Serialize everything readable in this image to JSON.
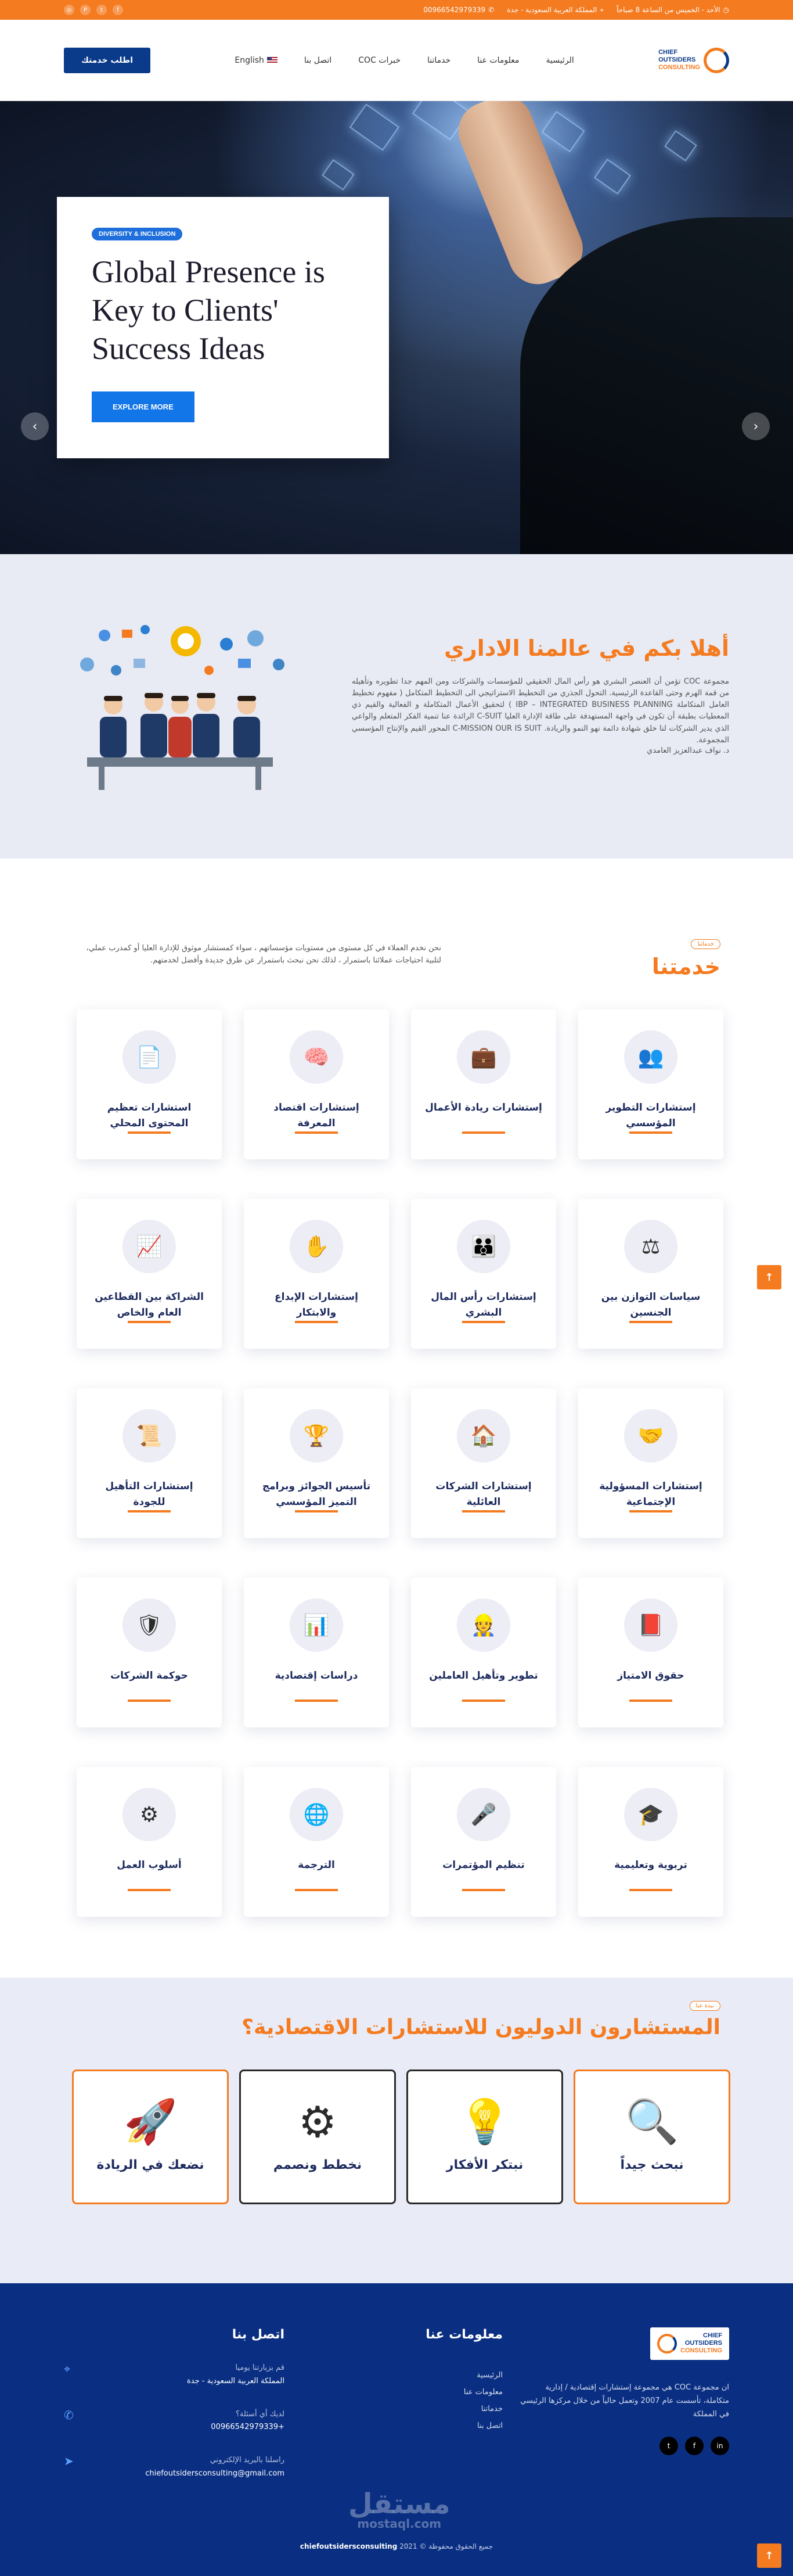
{
  "topbar": {
    "hours": "الأحد - الخميس من الساعة 8 صباحاً",
    "location": "المملكة العربية السعودية - جدة",
    "phone": "00966542979339",
    "social_icons": [
      "instagram-icon",
      "pinterest-icon",
      "twitter-icon",
      "facebook-icon"
    ]
  },
  "header": {
    "cta": "اطلب خدمتك",
    "lang": "English",
    "nav": [
      "الرئيسية",
      "معلومات عنا",
      "خدماتنا",
      "خبرات COC",
      "اتصل بنا"
    ],
    "logo": {
      "line1": "CHIEF",
      "line2": "OUTSIDERS",
      "line3": "CONSULTING"
    }
  },
  "hero": {
    "badge": "DIVERSITY & INCLUSION",
    "title": "Global Presence is Key to Clients' Success Ideas",
    "button": "EXPLORE MORE"
  },
  "welcome": {
    "title": "أهلا بكم في عالمنا الاداري",
    "body": "مجموعة COC تؤمن أن العنصر البشري هو رأس المال الحقيقي للمؤسسات والشركات ومن المهم جدا تطويره وتأهيله من قمة الهرم وحتى القاعدة الرئيسية. التحول الجذري من التخطيط الاستراتيجي الى التخطيط المتكامل ( مفهوم تخطيط العامل المتكاملة IBP – INTEGRATED BUSINESS PLANNING ) لتحقيق الأعمال المتكاملة و الفعالية والقيم ذي المعطيات بطبقة أن تكون في واجهة المستهدفة على طاقة الإدارة العليا C-SUIT الرائدة عنا تنمية الفكر المتعلم والواعي الذي يدير الشركات لنا خلق شهادة دائمة نهو النمو والريادة. C-MISSION OUR IS SUIT المحور القيم والإنتاج المؤسسي المجموعة.",
    "signature": "د. نواف عبدالعزيز العامدي"
  },
  "services": {
    "pill": "خدماتنا",
    "title": "خدمتنا",
    "intro": "نحن نخدم العملاء في كل مستوى من مستويات مؤسساتهم ، سواء كمستشار موثوق للإدارة العليا أو كمدرب عملي، لتلبية احتياجات عملائنا باستمرار ، لذلك نحن نبحث باستمرار عن طرق جديدة وأفضل لخدمتهم.",
    "items": [
      {
        "title": "إستشارات التطوير المؤسسي",
        "icon": "team-icon"
      },
      {
        "title": "إستشارات ريادة الأعمال",
        "icon": "entrepreneur-icon"
      },
      {
        "title": "إستشارات اقتصاد المعرفة",
        "icon": "brain-icon"
      },
      {
        "title": "استشارات تعظيم المحتوى المحلي",
        "icon": "document-icon"
      },
      {
        "title": "سياسات التوازن بين الجنسين",
        "icon": "balance-icon"
      },
      {
        "title": "إستشارات رأس المال البشري",
        "icon": "people-icon"
      },
      {
        "title": "إستشارات الإبداع والابتكار",
        "icon": "hand-idea-icon"
      },
      {
        "title": "الشراكة بين القطاعين العام والخاص",
        "icon": "growth-chart-icon"
      },
      {
        "title": "إستشارات المسؤولية الإجتماعية",
        "icon": "social-icon"
      },
      {
        "title": "إستشارات الشركات العائلية",
        "icon": "family-business-icon"
      },
      {
        "title": "تأسيس الجوائز وبرامج التميز المؤسسي",
        "icon": "award-icon"
      },
      {
        "title": "إستشارات التأهيل للجودة",
        "icon": "quality-certificate-icon"
      },
      {
        "title": "حقوق الامتياز",
        "icon": "franchise-book-icon"
      },
      {
        "title": "تطوير وتأهيل العاملين",
        "icon": "workforce-icon"
      },
      {
        "title": "دراسات إقتصادية",
        "icon": "economic-study-icon"
      },
      {
        "title": "حوكمة الشركات",
        "icon": "governance-icon"
      },
      {
        "title": "تربوية وتعليمية",
        "icon": "education-icon"
      },
      {
        "title": "تنظيم المؤتمرات",
        "icon": "conference-icon"
      },
      {
        "title": "الترجمة",
        "icon": "translation-icon"
      },
      {
        "title": "أسلوب العمل",
        "icon": "work-method-icon"
      }
    ]
  },
  "consultants": {
    "pill": "نبذة عنا",
    "title": "المستشارون الدوليون للاستشارات الاقتصادية؟",
    "steps": [
      {
        "label": "نبحث جيداً",
        "icon": "magnifier-icon"
      },
      {
        "label": "نبتكر الأفكار",
        "icon": "lightbulb-icon"
      },
      {
        "label": "نخطط ونصمم",
        "icon": "gears-icon"
      },
      {
        "label": "نضعك في الريادة",
        "icon": "rocket-icon"
      }
    ]
  },
  "footer": {
    "about": "ان مجموعة COC هي مجموعة إستشارات إقتصادية / إدارية متكاملة، تأسست عام 2007 وتعمل حالياً من خلال مركزها الرئيسي في المملكة",
    "links_title": "معلومات عنا",
    "links": [
      "الرئيسية",
      "معلومات عنا",
      "خدماتنا",
      "اتصل بنا"
    ],
    "contact_title": "اتصل بنا",
    "visit_label": "قم بزيارتنا يوميا",
    "address": "المملكة العربية السعودية - جدة",
    "question_label": "لديك أي أسئلة؟",
    "phone": "+00966542979339",
    "email_label": "راسلنا بالبريد الإلكتروني",
    "email": "chiefoutsidersconsulting@gmail.com",
    "social": [
      "twitter-icon",
      "facebook-icon",
      "linkedin-icon"
    ],
    "watermark_ar": "مستقل",
    "watermark_en": "mostaql.com",
    "copyright_text": "جميع الحقوق محفوظة ©",
    "copyright_year": "2021",
    "copyright_brand": "chiefoutsidersconsulting"
  },
  "colors": {
    "accent": "#f47b20",
    "brand_blue": "#0a3a8a",
    "footer": "#0a2f82"
  }
}
